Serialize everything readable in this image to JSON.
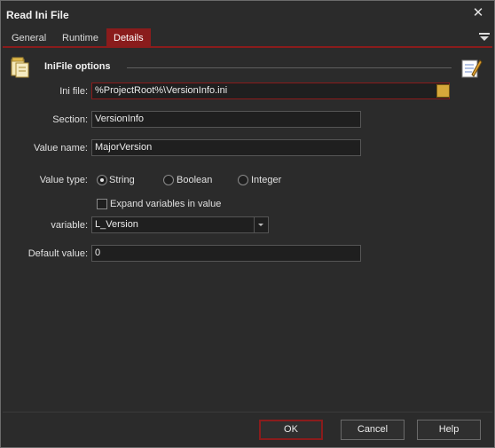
{
  "window": {
    "title": "Read Ini File",
    "close_glyph": "✕"
  },
  "tabs": [
    {
      "label": "General"
    },
    {
      "label": "Runtime"
    },
    {
      "label": "Details"
    }
  ],
  "active_tab": "Details",
  "section": {
    "title": "IniFile options"
  },
  "form": {
    "ini_file": {
      "label": "Ini file:",
      "value": "%ProjectRoot%\\VersionInfo.ini"
    },
    "section": {
      "label": "Section:",
      "value": "VersionInfo"
    },
    "value_name": {
      "label": "Value name:",
      "value": "MajorVersion"
    },
    "value_type": {
      "label": "Value type:",
      "options": [
        "String",
        "Boolean",
        "Integer"
      ],
      "selected": "String"
    },
    "expand_variables": {
      "label": "Expand variables in value",
      "checked": false
    },
    "variable": {
      "label": "variable:",
      "value": "L_Version"
    },
    "default_value": {
      "label": "Default value:",
      "value": "0"
    }
  },
  "buttons": {
    "ok": "OK",
    "cancel": "Cancel",
    "help": "Help"
  },
  "colors": {
    "accent": "#8a1c1c",
    "background": "#2b2b2b",
    "field_bg": "#1f1f1f"
  },
  "icons": [
    "inifile-icon",
    "notepad-edit-icon",
    "folder-browse-icon",
    "tab-menu-icon"
  ]
}
